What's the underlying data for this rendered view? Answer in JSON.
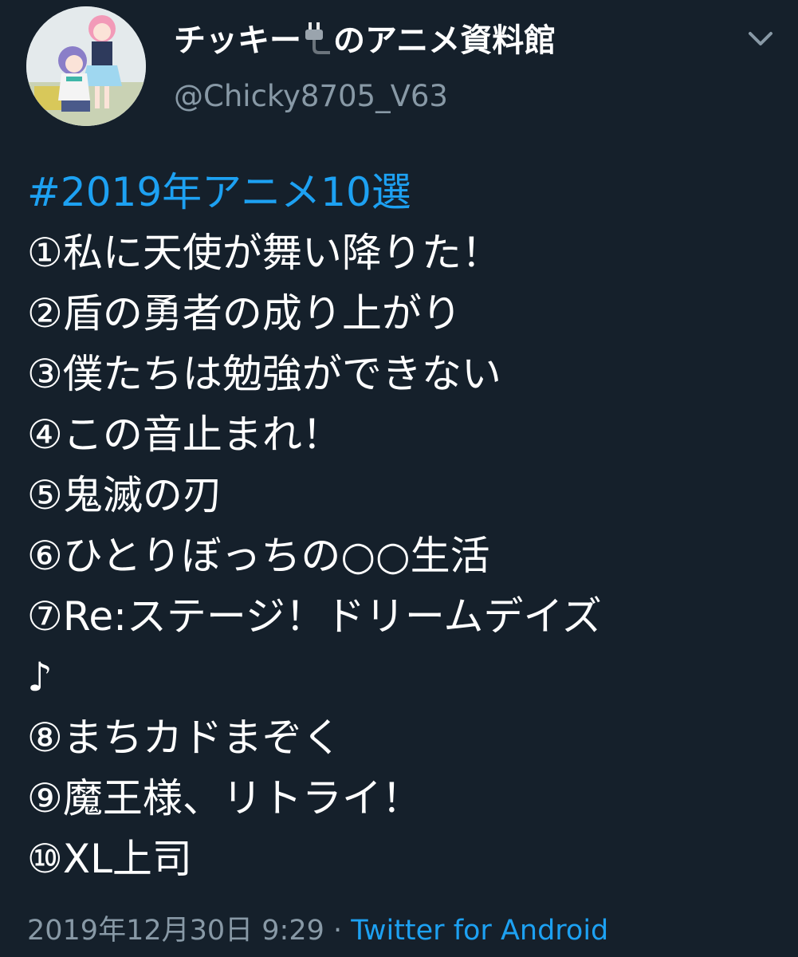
{
  "user": {
    "display_name_prefix": "チッキー",
    "display_name_suffix": "のアニメ資料館",
    "emoji_icon": "electric-plug-icon",
    "handle": "@Chicky8705_V63",
    "avatar_icon": "anime-characters-avatar"
  },
  "menu": {
    "icon": "chevron-down-icon"
  },
  "tweet": {
    "hashtag": "#2019年アニメ10選",
    "lines": [
      "①私に天使が舞い降りた！",
      "②盾の勇者の成り上がり",
      "③僕たちは勉強ができない",
      "④この音止まれ！",
      "⑤鬼滅の刃",
      "⑥ひとりぼっちの○○生活",
      "⑦Re:ステージ！ドリームデイズ",
      "♪",
      "⑧まちカドまぞく",
      "⑨魔王様、リトライ！",
      "⑩XL上司"
    ]
  },
  "meta": {
    "timestamp": "2019年12月30日 9:29",
    "separator": " · ",
    "source": "Twitter for Android"
  },
  "colors": {
    "background": "#15202b",
    "text": "#ffffff",
    "secondary": "#8899a6",
    "accent": "#1da1f2"
  }
}
